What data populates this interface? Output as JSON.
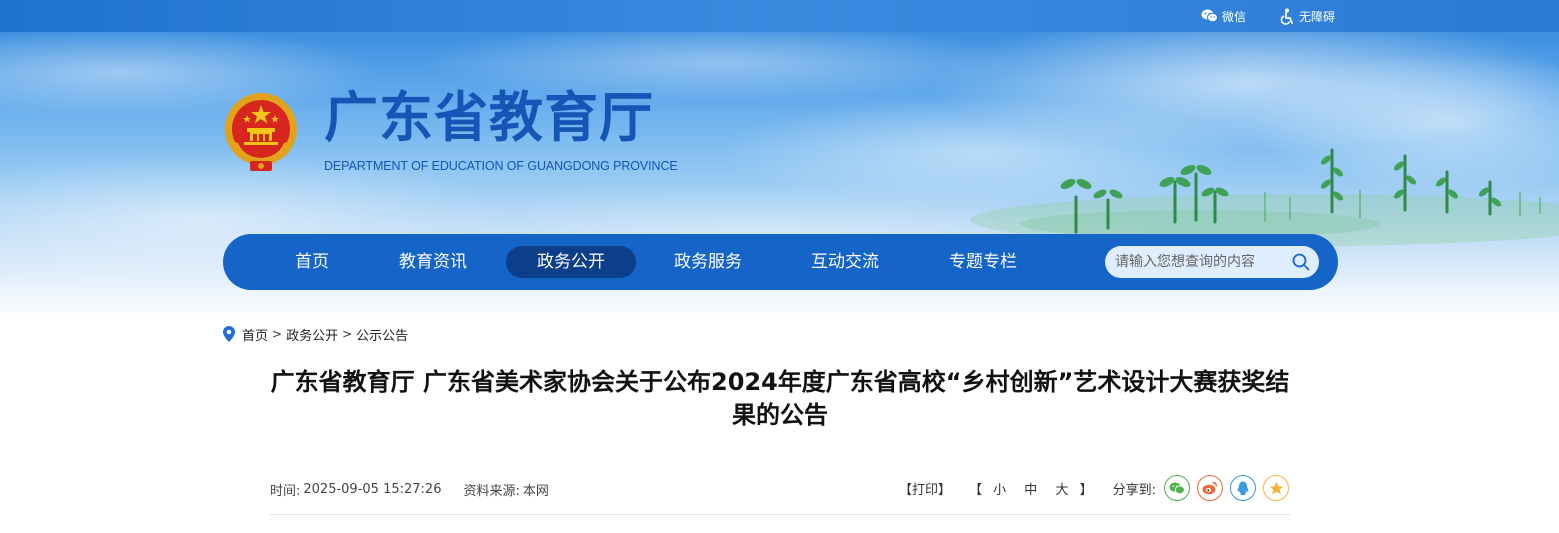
{
  "topbar": {
    "wechat_label": "微信",
    "accessibility_label": "无障碍"
  },
  "header": {
    "title": "广东省教育厅",
    "subtitle": "DEPARTMENT OF EDUCATION OF GUANGDONG PROVINCE"
  },
  "nav": {
    "items": [
      {
        "label": "首页",
        "active": false
      },
      {
        "label": "教育资讯",
        "active": false
      },
      {
        "label": "政务公开",
        "active": true
      },
      {
        "label": "政务服务",
        "active": false
      },
      {
        "label": "互动交流",
        "active": false
      },
      {
        "label": "专题专栏",
        "active": false
      }
    ],
    "search_placeholder": "请输入您想查询的内容"
  },
  "breadcrumb": {
    "items": [
      "首页",
      "政务公开",
      "公示公告"
    ],
    "separator": ">"
  },
  "article": {
    "title": "广东省教育厅 广东省美术家协会关于公布2024年度广东省高校“乡村创新”艺术设计大赛获奖结果的公告",
    "time_label": "时间:",
    "time_value": "2025-09-05 15:27:26",
    "source_label": "资料来源:",
    "source_value": "本网"
  },
  "tools": {
    "print": "【打印】",
    "font_open": "【",
    "font_small": "小",
    "font_medium": "中",
    "font_large": "大",
    "font_close": "】",
    "share_label": "分享到:",
    "share_icons": [
      "wechat-icon",
      "weibo-icon",
      "qq-icon",
      "qzone-icon"
    ]
  },
  "colors": {
    "topbar": "#2a7ad6",
    "nav": "#1565c8",
    "nav_active": "#0b3f8a",
    "title_blue": "#1455b6",
    "wechat": "#4db24a",
    "weibo": "#ea6b3c",
    "qq": "#3a9be0",
    "qzone": "#f3b33a"
  }
}
